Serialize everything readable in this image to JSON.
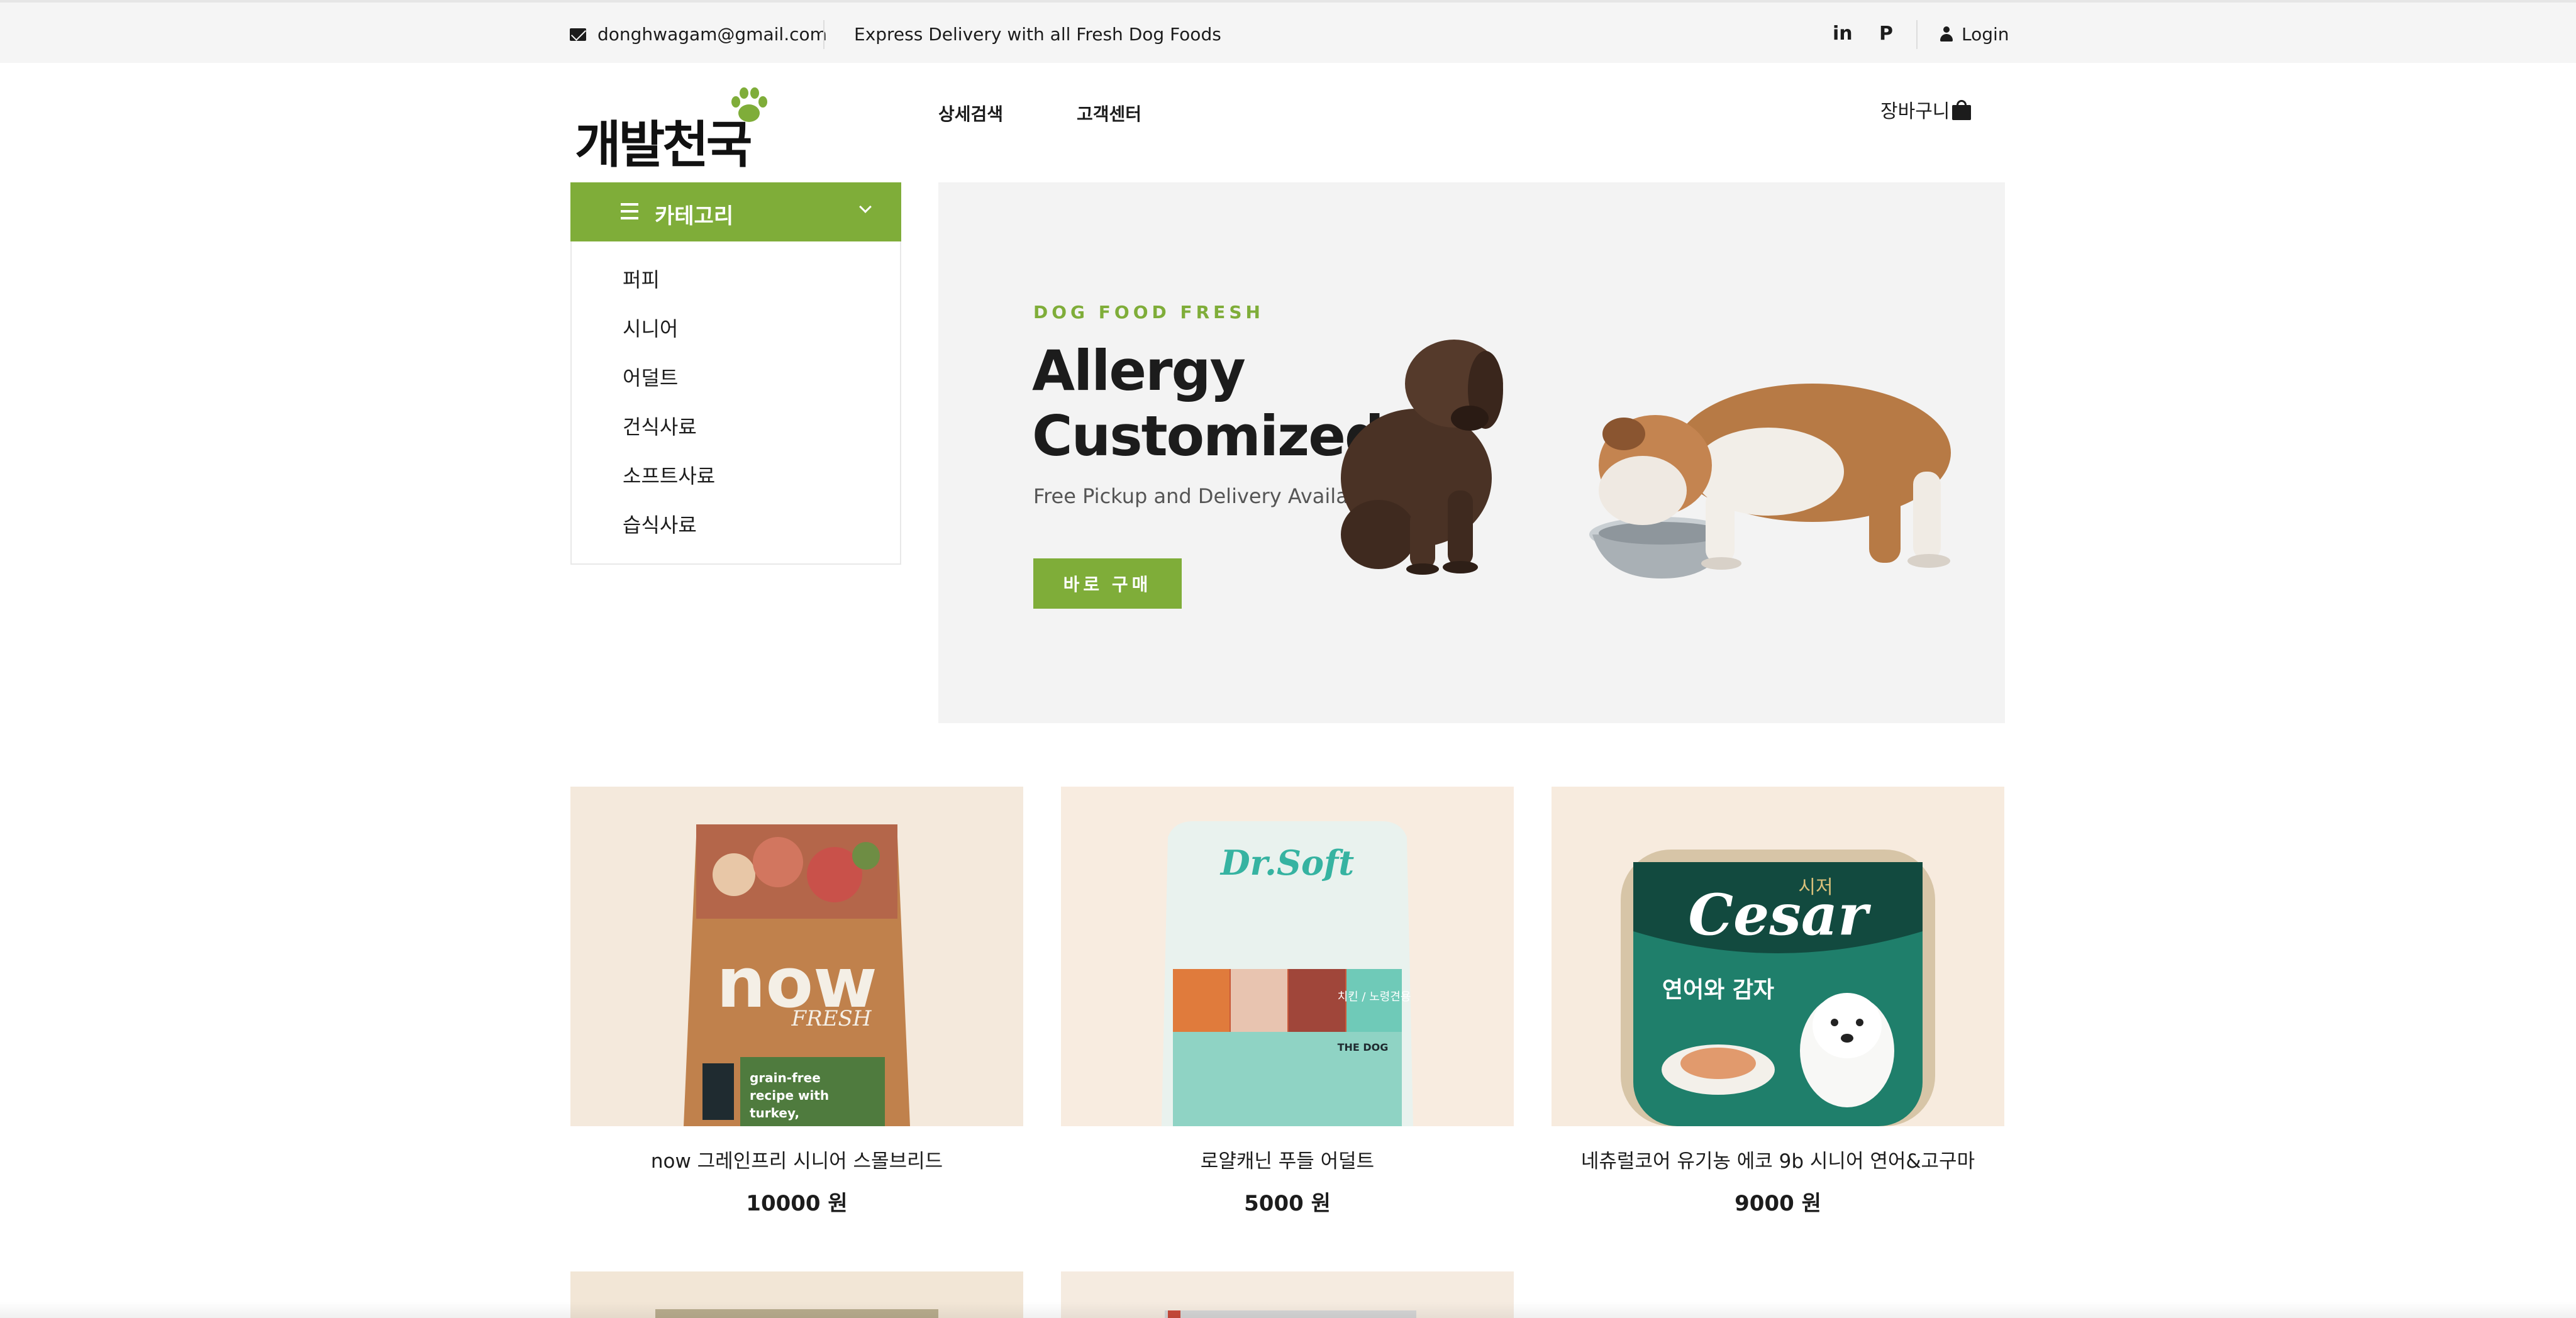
{
  "topbar": {
    "email": "donghwagam@gmail.com",
    "promo": "Express Delivery with all Fresh Dog Foods",
    "linkedin_label": "in",
    "pinterest_label": "P",
    "login_label": "Login"
  },
  "header": {
    "logo_text": "개발천국",
    "nav": {
      "detail_search": "상세검색",
      "customer_center": "고객센터"
    },
    "cart_label": "장바구니"
  },
  "category": {
    "title": "카테고리",
    "items": [
      "퍼피",
      "시니어",
      "어덜트",
      "건식사료",
      "소프트사료",
      "습식사료"
    ]
  },
  "hero": {
    "eyebrow": "DOG FOOD FRESH",
    "headline_line1": "Allergy",
    "headline_line2": "Customized",
    "subtitle": "Free Pickup and Delivery Available",
    "button_label": "바로 구매"
  },
  "products": [
    {
      "name": "now 그레인프리 시니어 스몰브리드",
      "price": "10000 원",
      "package_text": "now",
      "package_sub": "FRESH",
      "package_note": "grain-free recipe with turkey, salmon"
    },
    {
      "name": "로얄캐닌 푸들 어덜트",
      "price": "5000 원",
      "package_text": "Dr.Soft",
      "package_sub": "치킨 / 노령견용",
      "package_note": "THE DOG"
    },
    {
      "name": "네츄럴코어 유기농 에코 9b 시니어 연어&고구마",
      "price": "9000 원",
      "package_text": "Cesar",
      "package_sub": "시저",
      "package_note": "연어와 감자"
    }
  ],
  "colors": {
    "accent": "#7fad39",
    "topbar_bg": "#f5f5f5",
    "hero_bg": "#f3f3f3",
    "text": "#1c1c1c"
  },
  "icons": [
    "mail-icon",
    "linkedin-icon",
    "pinterest-icon",
    "user-icon",
    "shopping-bag-icon",
    "hamburger-icon",
    "chevron-down-icon",
    "paw-icon"
  ]
}
